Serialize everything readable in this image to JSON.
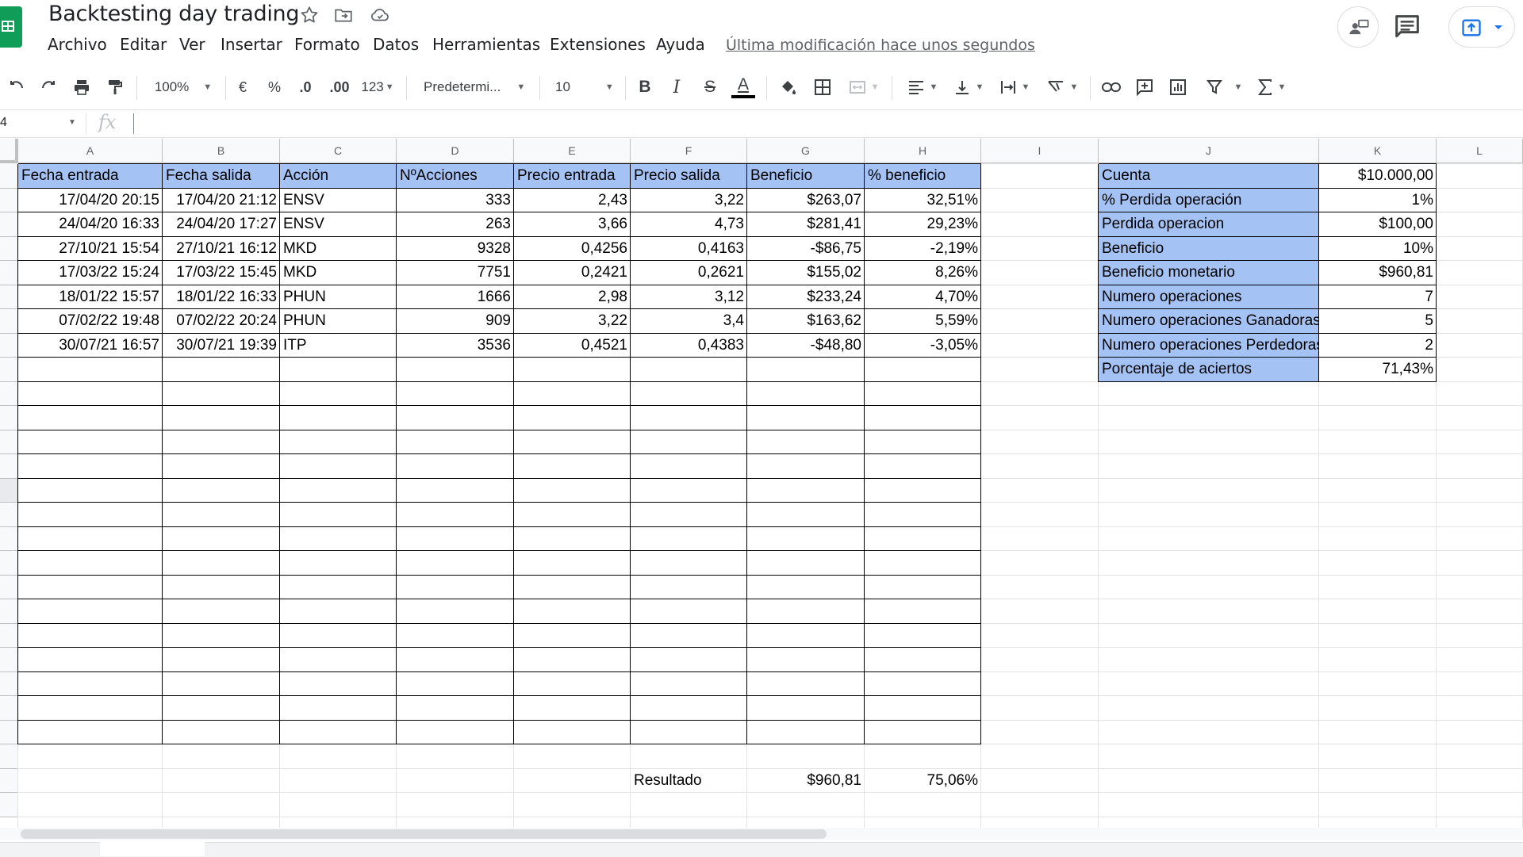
{
  "app": {
    "title": "Backtesting day trading",
    "last_edit": "Última modificación hace unos segundos",
    "menu": [
      "Archivo",
      "Editar",
      "Ver",
      "Insertar",
      "Formato",
      "Datos",
      "Herramientas",
      "Extensiones",
      "Ayuda"
    ]
  },
  "toolbar": {
    "zoom": "100%",
    "currency": "€",
    "percent": "%",
    "decrease_decimals": ".0",
    "increase_decimals": ".00",
    "more_formats": "123",
    "font": "Predetermi...",
    "font_size": "10",
    "bold": "B",
    "italic": "I",
    "strikethrough": "S",
    "text_color": "A"
  },
  "formula_bar": {
    "name_box": "4",
    "fx": "fx"
  },
  "columns": [
    "A",
    "B",
    "C",
    "D",
    "E",
    "F",
    "G",
    "H",
    "I",
    "J",
    "K",
    "L"
  ],
  "trades": {
    "headers": [
      "Fecha entrada",
      "Fecha salida",
      "Acción",
      "NºAcciones",
      "Precio entrada",
      "Precio salida",
      "Beneficio",
      "% beneficio"
    ],
    "rows": [
      [
        "17/04/20 20:15",
        "17/04/20 21:12",
        "ENSV",
        "333",
        "2,43",
        "3,22",
        "$263,07",
        "32,51%"
      ],
      [
        "24/04/20 16:33",
        "24/04/20 17:27",
        "ENSV",
        "263",
        "3,66",
        "4,73",
        "$281,41",
        "29,23%"
      ],
      [
        "27/10/21 15:54",
        "27/10/21 16:12",
        "MKD",
        "9328",
        "0,4256",
        "0,4163",
        "-$86,75",
        "-2,19%"
      ],
      [
        "17/03/22 15:24",
        "17/03/22 15:45",
        "MKD",
        "7751",
        "0,2421",
        "0,2621",
        "$155,02",
        "8,26%"
      ],
      [
        "18/01/22 15:57",
        "18/01/22 16:33",
        "PHUN",
        "1666",
        "2,98",
        "3,12",
        "$233,24",
        "4,70%"
      ],
      [
        "07/02/22 19:48",
        "07/02/22 20:24",
        "PHUN",
        "909",
        "3,22",
        "3,4",
        "$163,62",
        "5,59%"
      ],
      [
        "30/07/21 16:57",
        "30/07/21 19:39",
        "ITP",
        "3536",
        "0,4521",
        "0,4383",
        "-$48,80",
        "-3,05%"
      ]
    ],
    "result_label": "Resultado",
    "result_profit": "$960,81",
    "result_percent": "75,06%"
  },
  "summary": [
    {
      "label": "Cuenta",
      "value": "$10.000,00"
    },
    {
      "label": "% Perdida operación",
      "value": "1%"
    },
    {
      "label": "Perdida operacion",
      "value": "$100,00"
    },
    {
      "label": "Beneficio",
      "value": "10%"
    },
    {
      "label": "Beneficio monetario",
      "value": "$960,81"
    },
    {
      "label": "Numero operaciones",
      "value": "7"
    },
    {
      "label": "Numero operaciones Ganadoras",
      "value": "5"
    },
    {
      "label": "Numero operaciones Perdedoras",
      "value": "2"
    },
    {
      "label": "Porcentaje de aciertos",
      "value": "71,43%"
    }
  ],
  "colors": {
    "header_fill": "#a4c2f4",
    "logo_green": "#0f9d58",
    "share_blue": "#1a73e8"
  }
}
